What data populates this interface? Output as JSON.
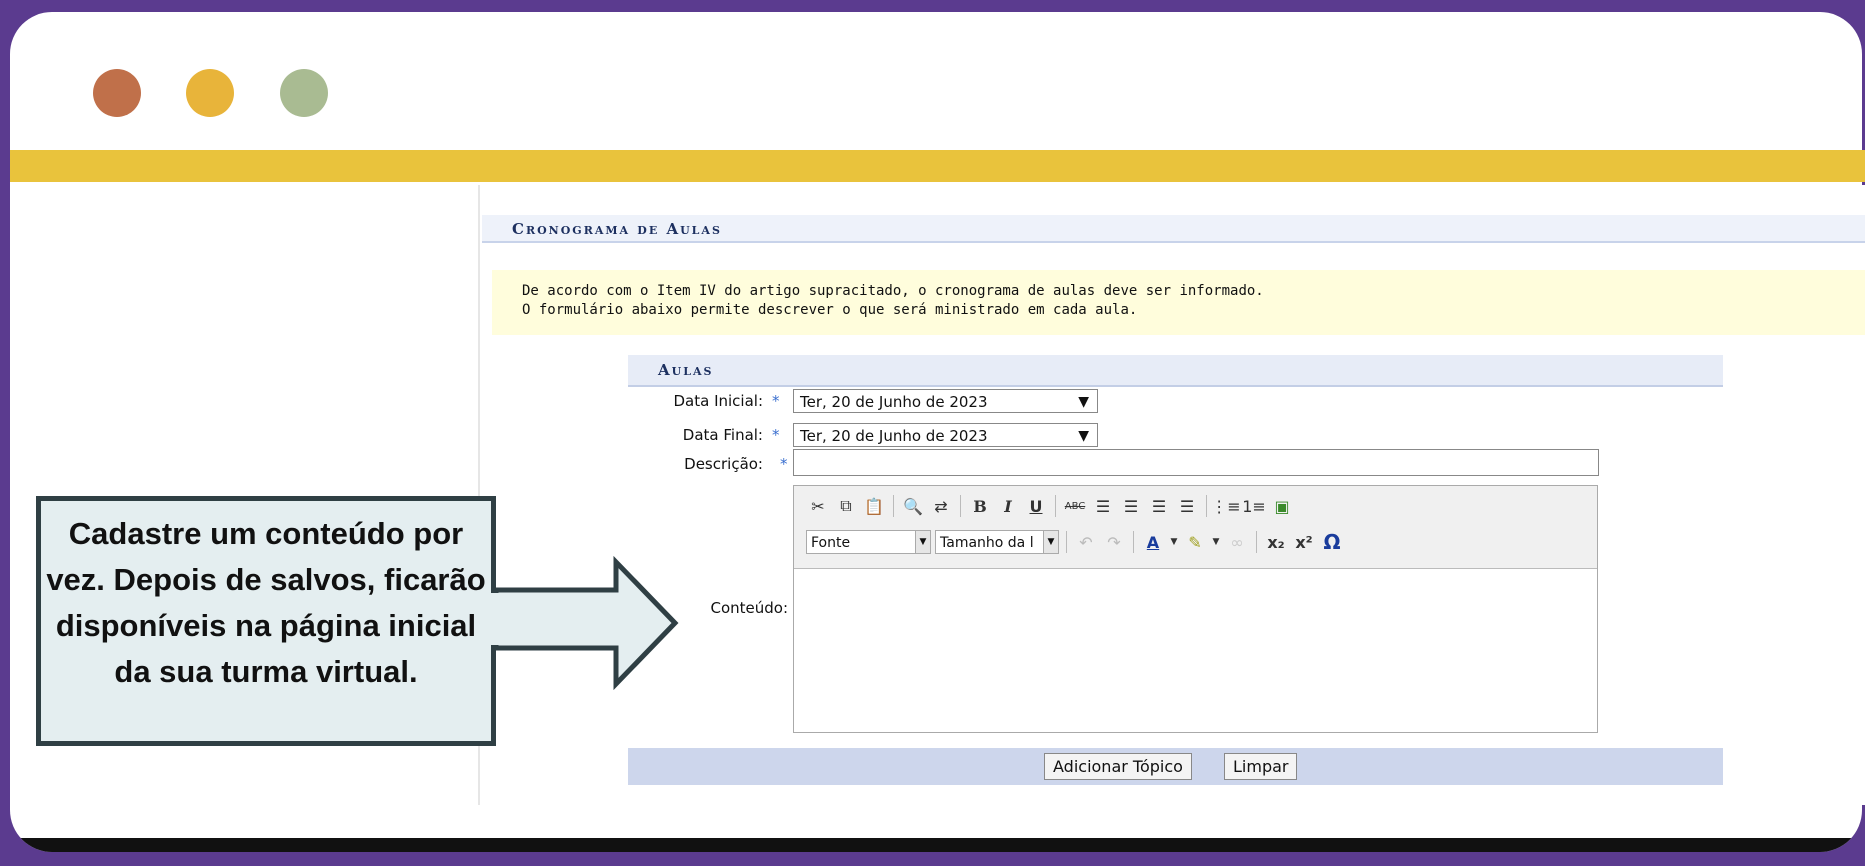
{
  "page": {
    "title": "Cronograma de Aulas",
    "info_lines": [
      "De acordo com o Item IV do artigo supracitado, o cronograma de aulas deve ser informado.",
      "O formulário abaixo permite descrever o que será ministrado em cada aula."
    ]
  },
  "form": {
    "section_title": "Aulas",
    "data_inicial_label": "Data Inicial:",
    "data_inicial_value": "Ter, 20 de Junho de 2023",
    "data_final_label": "Data Final:",
    "data_final_value": "Ter, 20 de Junho de 2023",
    "descricao_label": "Descrição:",
    "descricao_value": "",
    "conteudo_label": "Conteúdo:",
    "required_mark": "*"
  },
  "editor": {
    "font_select": "Fonte",
    "size_select": "Tamanho da l"
  },
  "buttons": {
    "add_topic": "Adicionar Tópico",
    "clear": "Limpar"
  },
  "callout": {
    "text": "Cadastre um conteúdo por vez. Depois de salvos, ficarão disponíveis na página inicial da sua turma virtual."
  },
  "colors": {
    "background_purple": "#5b3b8f",
    "accent_yellow": "#e9c33c",
    "dot_red": "#c0704a",
    "dot_yellow": "#e8b43a",
    "dot_green": "#a9bb92",
    "title_blue": "#1d3060"
  }
}
